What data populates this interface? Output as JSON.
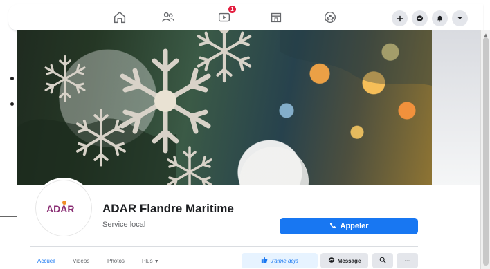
{
  "colors": {
    "accent": "#1877f2",
    "badge": "#e41e3f",
    "text_primary": "#1c1e21",
    "text_secondary": "#65676b",
    "button_gray": "#e4e6eb",
    "liked_bg": "#e7f3ff"
  },
  "topbar": {
    "nav_icons": [
      "home-icon",
      "friends-icon",
      "watch-icon",
      "marketplace-icon",
      "groups-icon"
    ],
    "notification_count": "1",
    "right_actions": [
      "plus-icon",
      "messenger-icon",
      "notifications-icon",
      "chevron-down-icon"
    ]
  },
  "page": {
    "name": "ADAR Flandre Maritime",
    "category": "Service local",
    "logo_text": "ADAR"
  },
  "buttons": {
    "call": "Appeler",
    "liked": "J'aime déjà",
    "message": "Message",
    "more": "···"
  },
  "tabs": [
    "Accueil",
    "Vidéos",
    "Photos",
    "Plus"
  ]
}
